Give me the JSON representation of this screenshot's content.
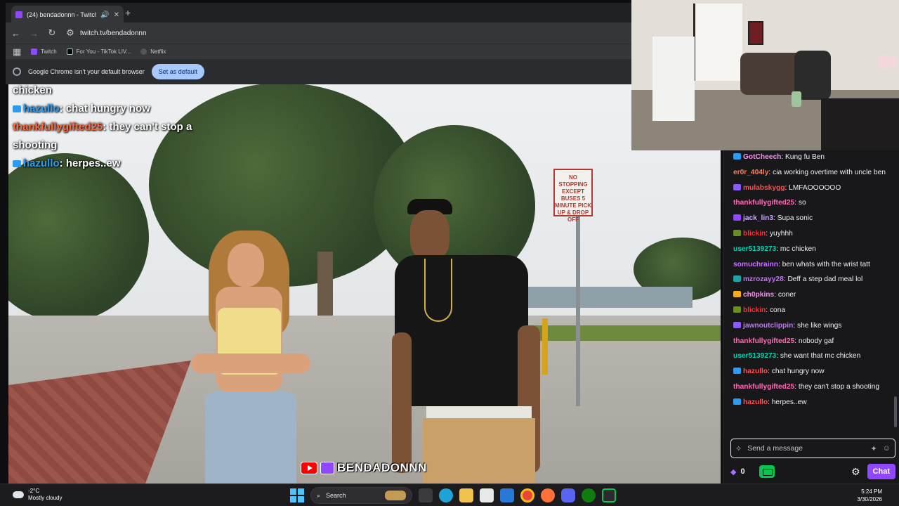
{
  "browser": {
    "tab_title": "(24) bendadonnn - Twitch",
    "url": "twitch.tv/bendadonnn",
    "bookmarks": [
      {
        "label": "Twitch",
        "color": "#9146ff"
      },
      {
        "label": "For You - TikTok LIV...",
        "color": "#010101"
      },
      {
        "label": "Netflix",
        "color": "#e50914"
      }
    ],
    "infobar_text": "Google Chrome isn't your default browser",
    "infobar_button": "Set as default"
  },
  "video": {
    "sign_text": "NO STOPPING EXCEPT BUSES 5 MINUTE PICK UP & DROP OFF",
    "overlay_chat": [
      {
        "user": "",
        "text": "chicken",
        "color": "#ffffff",
        "badge": false
      },
      {
        "user": "hazullo",
        "text": "chat hungry now",
        "color": "#2d9cf0",
        "badge": true
      },
      {
        "user": "thankfullygifted25",
        "text": "they can't stop a shooting",
        "color": "#ff6a3d",
        "badge": false
      },
      {
        "user": "hazullo",
        "text": "herpes..ew",
        "color": "#2d9cf0",
        "badge": true
      }
    ],
    "watermark": "BENDADONNN"
  },
  "chat": {
    "messages": [
      {
        "user": "GotCheech",
        "text": "Kung fu Ben",
        "color": "#ff8af7",
        "badge": "#2d9cf0"
      },
      {
        "user": "er0r_404ly",
        "text": "cia working overtime with uncle ben",
        "color": "#ff7b54",
        "badge": ""
      },
      {
        "user": "mulabskygg",
        "text": "LMFAOOOOOO",
        "color": "#ff4d4d",
        "badge": "#8a5cf6"
      },
      {
        "user": "thankfullygifted25",
        "text": "so",
        "color": "#ff69b4",
        "badge": ""
      },
      {
        "user": "jack_lin3",
        "text": "Supa sonic",
        "color": "#c9a6ff",
        "badge": "#9146ff"
      },
      {
        "user": "blickin",
        "text": "yuyhhh",
        "color": "#ff2d2d",
        "badge": "#6b8e23"
      },
      {
        "user": "user5139273",
        "text": "mc chicken",
        "color": "#00d4b0",
        "badge": ""
      },
      {
        "user": "somuchrainn",
        "text": "ben whats with the wrist tatt",
        "color": "#c471ff",
        "badge": ""
      },
      {
        "user": "mzrozayy28",
        "text": "Deff a step dad meal lol",
        "color": "#c471ff",
        "badge": "#1fa3a3"
      },
      {
        "user": "ch0pkins",
        "text": "coner",
        "color": "#ff8af7",
        "badge": "#f2b01e"
      },
      {
        "user": "blickin",
        "text": "cona",
        "color": "#ff2d2d",
        "badge": "#6b8e23"
      },
      {
        "user": "jawnoutclippin",
        "text": "she like wings",
        "color": "#c471ff",
        "badge": "#8a5cf6"
      },
      {
        "user": "thankfullygifted25",
        "text": "nobody gaf",
        "color": "#ff69b4",
        "badge": ""
      },
      {
        "user": "user5139273",
        "text": "she want that mc chicken",
        "color": "#00d4b0",
        "badge": ""
      },
      {
        "user": "hazullo",
        "text": "chat hungry now",
        "color": "#ff4d4d",
        "badge": "#2d9cf0"
      },
      {
        "user": "thankfullygifted25",
        "text": "they can't stop a shooting",
        "color": "#ff69b4",
        "badge": ""
      },
      {
        "user": "hazullo",
        "text": "herpes..ew",
        "color": "#ff4d4d",
        "badge": "#2d9cf0"
      }
    ],
    "input_placeholder": "Send a message",
    "points": "0",
    "chat_button": "Chat"
  },
  "taskbar": {
    "temperature": "-2°C",
    "weather": "Mostly cloudy",
    "search_label": "Search",
    "time": "5:24 PM",
    "date": "3/30/2026"
  }
}
